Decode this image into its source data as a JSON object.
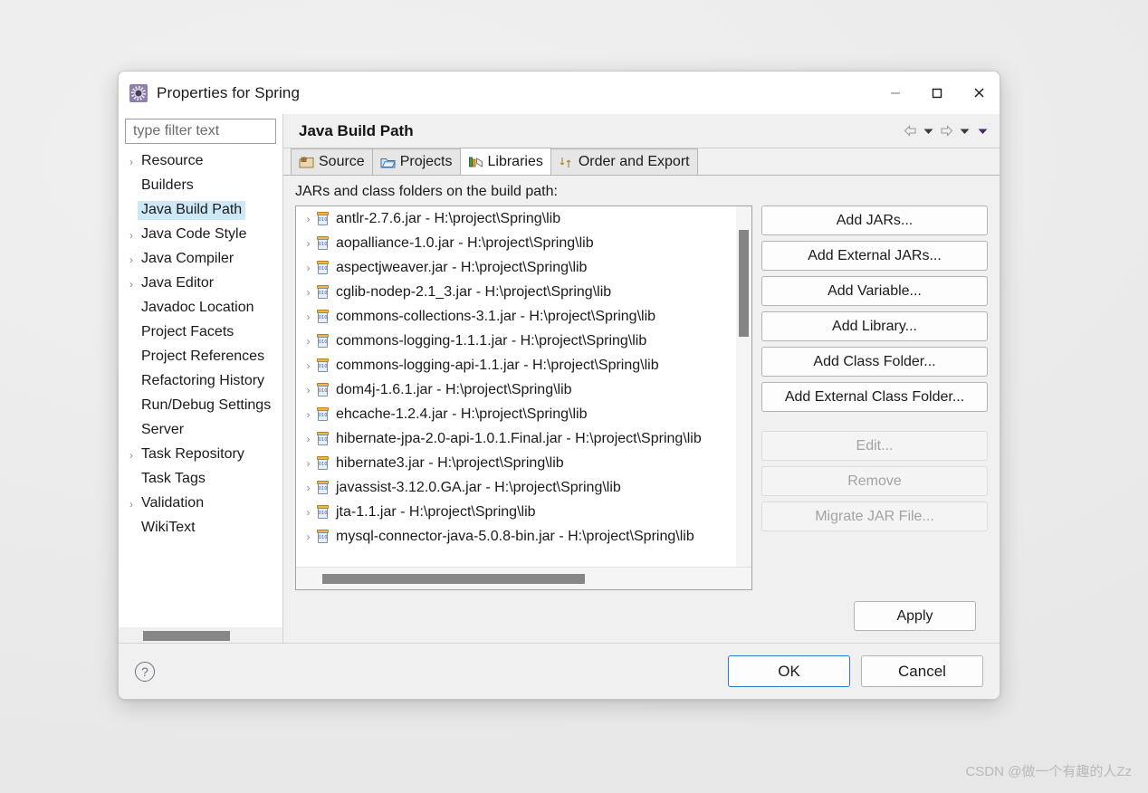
{
  "window": {
    "title": "Properties for Spring",
    "icon": "properties-gear-icon",
    "controls": {
      "minimize": "—",
      "maximize": "□",
      "close": "✕"
    }
  },
  "sidebar": {
    "filter": {
      "value": "",
      "placeholder": "type filter text"
    },
    "items": [
      {
        "label": "Resource",
        "expandable": true,
        "selected": false
      },
      {
        "label": "Builders",
        "expandable": false,
        "selected": false
      },
      {
        "label": "Java Build Path",
        "expandable": false,
        "selected": true
      },
      {
        "label": "Java Code Style",
        "expandable": true,
        "selected": false
      },
      {
        "label": "Java Compiler",
        "expandable": true,
        "selected": false
      },
      {
        "label": "Java Editor",
        "expandable": true,
        "selected": false
      },
      {
        "label": "Javadoc Location",
        "expandable": false,
        "selected": false
      },
      {
        "label": "Project Facets",
        "expandable": false,
        "selected": false
      },
      {
        "label": "Project References",
        "expandable": false,
        "selected": false
      },
      {
        "label": "Refactoring History",
        "expandable": false,
        "selected": false
      },
      {
        "label": "Run/Debug Settings",
        "expandable": false,
        "selected": false
      },
      {
        "label": "Server",
        "expandable": false,
        "selected": false
      },
      {
        "label": "Task Repository",
        "expandable": true,
        "selected": false
      },
      {
        "label": "Task Tags",
        "expandable": false,
        "selected": false
      },
      {
        "label": "Validation",
        "expandable": true,
        "selected": false
      },
      {
        "label": "WikiText",
        "expandable": false,
        "selected": false
      }
    ]
  },
  "page": {
    "title": "Java Build Path",
    "nav": {
      "back": "⇦",
      "back_menu": "▼",
      "forward": "⇨",
      "forward_menu": "▼",
      "view_menu": "▼"
    },
    "tabs": [
      {
        "label": "Source",
        "icon": "source-package-icon",
        "active": false
      },
      {
        "label": "Projects",
        "icon": "projects-folder-icon",
        "active": false
      },
      {
        "label": "Libraries",
        "icon": "libraries-books-icon",
        "active": true
      },
      {
        "label": "Order and Export",
        "icon": "order-export-arrows-icon",
        "active": false
      }
    ],
    "list_label": "JARs and class folders on the build path:",
    "entries": [
      {
        "name": "antlr-2.7.6.jar - H:\\project\\Spring\\lib"
      },
      {
        "name": "aopalliance-1.0.jar - H:\\project\\Spring\\lib"
      },
      {
        "name": "aspectjweaver.jar - H:\\project\\Spring\\lib"
      },
      {
        "name": "cglib-nodep-2.1_3.jar - H:\\project\\Spring\\lib"
      },
      {
        "name": "commons-collections-3.1.jar - H:\\project\\Spring\\lib"
      },
      {
        "name": "commons-logging-1.1.1.jar - H:\\project\\Spring\\lib"
      },
      {
        "name": "commons-logging-api-1.1.jar - H:\\project\\Spring\\lib"
      },
      {
        "name": "dom4j-1.6.1.jar - H:\\project\\Spring\\lib"
      },
      {
        "name": "ehcache-1.2.4.jar - H:\\project\\Spring\\lib"
      },
      {
        "name": "hibernate-jpa-2.0-api-1.0.1.Final.jar - H:\\project\\Spring\\lib"
      },
      {
        "name": "hibernate3.jar - H:\\project\\Spring\\lib"
      },
      {
        "name": "javassist-3.12.0.GA.jar - H:\\project\\Spring\\lib"
      },
      {
        "name": "jta-1.1.jar - H:\\project\\Spring\\lib"
      },
      {
        "name": "mysql-connector-java-5.0.8-bin.jar - H:\\project\\Spring\\lib"
      }
    ],
    "buttons": [
      {
        "label": "Add JARs...",
        "enabled": true
      },
      {
        "label": "Add External JARs...",
        "enabled": true
      },
      {
        "label": "Add Variable...",
        "enabled": true
      },
      {
        "label": "Add Library...",
        "enabled": true
      },
      {
        "label": "Add Class Folder...",
        "enabled": true
      },
      {
        "label": "Add External Class Folder...",
        "enabled": true
      },
      {
        "label": "Edit...",
        "enabled": false
      },
      {
        "label": "Remove",
        "enabled": false
      },
      {
        "label": "Migrate JAR File...",
        "enabled": false
      }
    ],
    "apply_label": "Apply"
  },
  "footer": {
    "help_icon": "help-question-icon",
    "help_glyph": "?",
    "ok_label": "OK",
    "cancel_label": "Cancel"
  },
  "watermark": "CSDN @做一个有趣的人Zz",
  "colors": {
    "selection": "#cde8f7",
    "default_button_border": "#2c7ac9",
    "dialog_bg": "#f0f0f0",
    "scrollbar_thumb": "#878787"
  }
}
